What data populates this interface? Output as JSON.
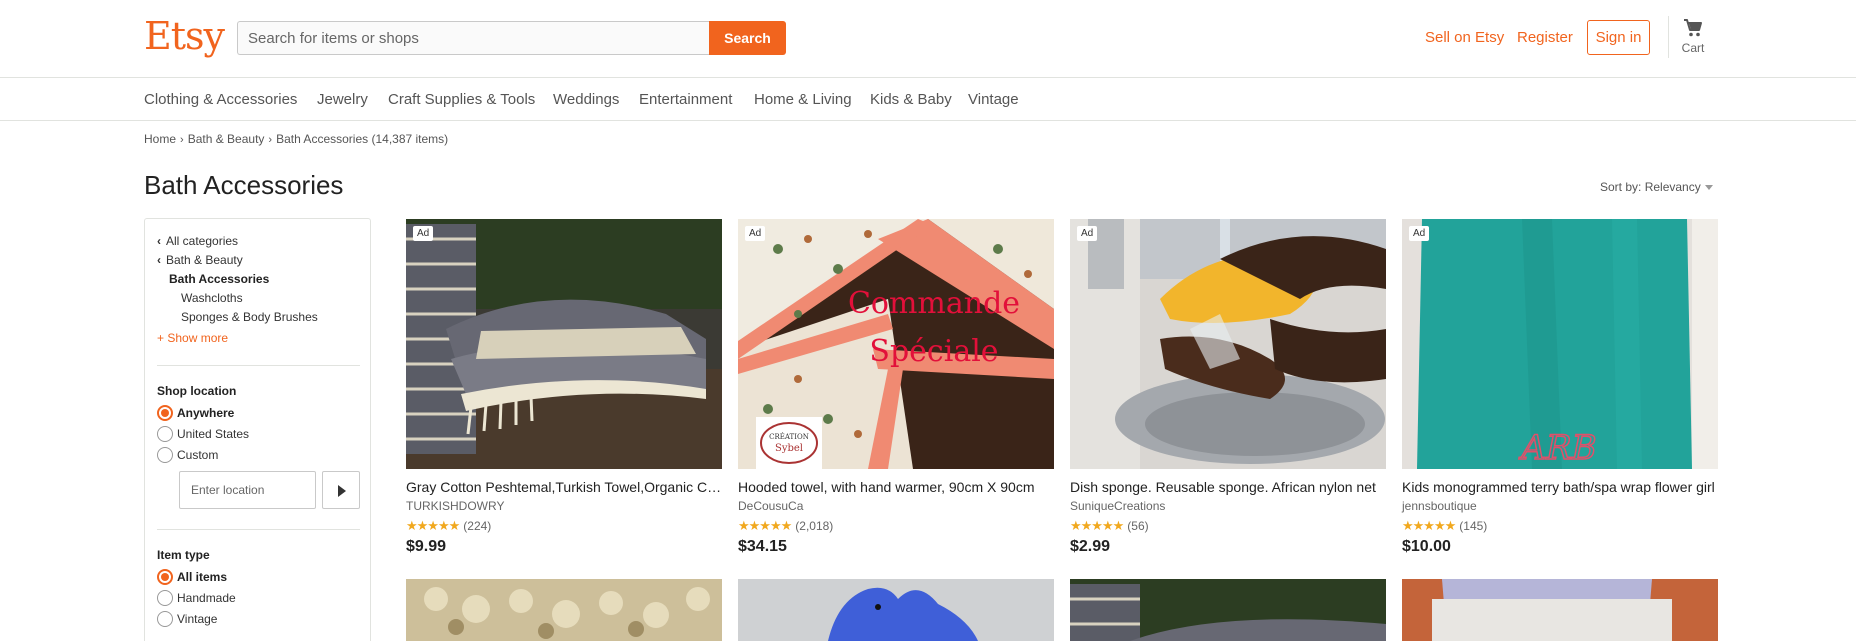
{
  "brand": {
    "logo": "Etsy",
    "accent_color": "#f1641e"
  },
  "search": {
    "placeholder": "Search for items or shops",
    "button_label": "Search"
  },
  "header": {
    "sell_label": "Sell on Etsy",
    "register_label": "Register",
    "signin_label": "Sign in",
    "cart_label": "Cart",
    "cart_icon": "cart-icon"
  },
  "categories": [
    "Clothing & Accessories",
    "Jewelry",
    "Craft Supplies & Tools",
    "Weddings",
    "Entertainment",
    "Home & Living",
    "Kids & Baby",
    "Vintage"
  ],
  "breadcrumb": {
    "items": [
      "Home",
      "Bath & Beauty",
      "Bath Accessories"
    ],
    "count": "(14,387 items)"
  },
  "page": {
    "title": "Bath Accessories"
  },
  "sort": {
    "label": "Sort by:",
    "value": "Relevancy"
  },
  "sidebar": {
    "all_categories": "All categories",
    "parent": "Bath & Beauty",
    "current": "Bath Accessories",
    "subcategories": [
      "Washcloths",
      "Sponges & Body Brushes"
    ],
    "show_more": "+ Show more",
    "shop_location": {
      "heading": "Shop location",
      "options": [
        "Anywhere",
        "United States",
        "Custom"
      ],
      "selected": "Anywhere",
      "input_placeholder": "Enter location"
    },
    "item_type": {
      "heading": "Item type",
      "options": [
        "All items",
        "Handmade",
        "Vintage"
      ],
      "selected": "All items"
    }
  },
  "listings": [
    {
      "ad": "Ad",
      "title": "Gray Cotton Peshtemal,Turkish Towel,Organic Cotton Towel,Beach Towel",
      "shop": "TURKISHDOWRY",
      "stars": "★★★★★",
      "reviews": "(224)",
      "rating": 5,
      "price": "$9.99"
    },
    {
      "ad": "Ad",
      "title": "Hooded towel, with hand warmer, 90cm X 90cm",
      "shop": "DeCousuCa",
      "stars": "★★★★★",
      "reviews": "(2,018)",
      "rating": 5,
      "price": "$34.15",
      "overlay_text": [
        "Commande",
        "Spéciale"
      ],
      "logo_text": [
        "CRÉATION",
        "Sybel"
      ]
    },
    {
      "ad": "Ad",
      "title": "Dish sponge. Reusable sponge. African nylon net",
      "shop": "SuniqueCreations",
      "stars": "★★★★★",
      "reviews": "(56)",
      "rating": 5,
      "price": "$2.99"
    },
    {
      "ad": "Ad",
      "title": "Kids monogrammed terry bath/spa wrap flower girl",
      "shop": "jennsboutique",
      "stars": "★★★★★",
      "reviews": "(145)",
      "rating": 5,
      "price": "$10.00",
      "monogram": "ARB"
    }
  ]
}
